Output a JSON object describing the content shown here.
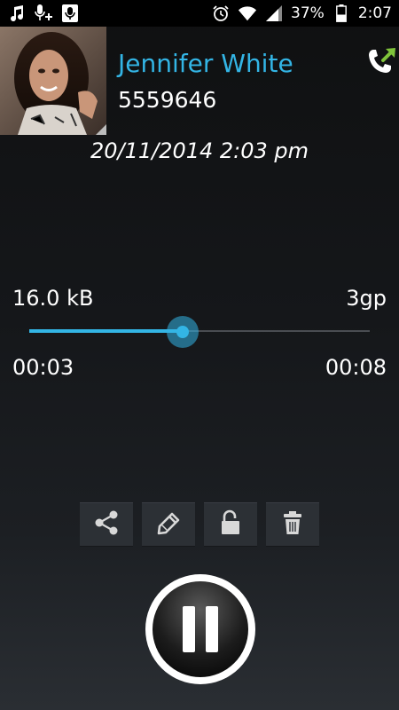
{
  "status_bar": {
    "battery": "37%",
    "time": "2:07",
    "icons_left": [
      "music-note-icon",
      "mic-add-icon",
      "voicemail-icon"
    ],
    "icons_right": [
      "alarm-icon",
      "wifi-icon",
      "signal-icon"
    ]
  },
  "contact": {
    "name": "Jennifer White",
    "number": "5559646",
    "call_type_icon": "outgoing-call-icon"
  },
  "recording": {
    "datetime": "20/11/2014 2:03 pm",
    "size": "16.0 kB",
    "format": "3gp",
    "elapsed": "00:03",
    "duration": "00:08",
    "progress": 0.45
  },
  "actions": [
    {
      "name": "share",
      "icon": "share-icon"
    },
    {
      "name": "rename",
      "icon": "pencil-icon"
    },
    {
      "name": "lock",
      "icon": "lock-icon"
    },
    {
      "name": "delete",
      "icon": "trash-icon"
    }
  ],
  "player": {
    "state_icon": "pause-icon"
  },
  "colors": {
    "accent": "#33b5e5",
    "call_arrow": "#7fc33a"
  }
}
